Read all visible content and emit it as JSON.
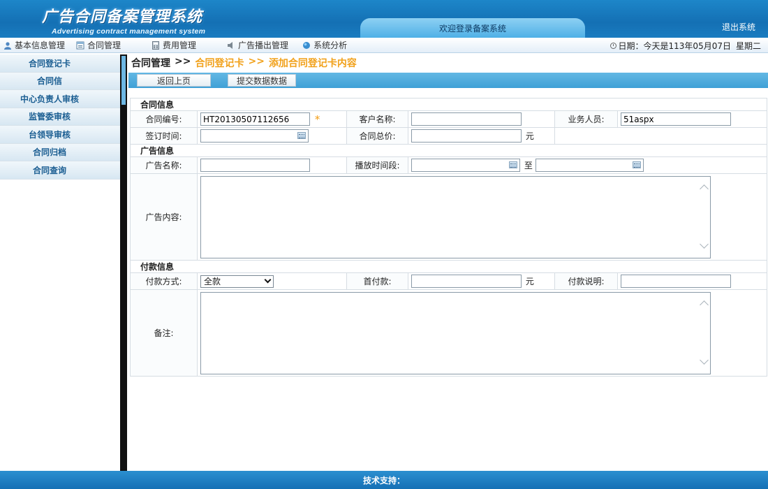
{
  "header": {
    "title": "广告合同备案管理系统",
    "subtitle": "Advertising contract management system",
    "welcome": "欢迎登录备案系统",
    "logout": "退出系统"
  },
  "topmenu": {
    "items": [
      {
        "label": "基本信息管理",
        "icon": "user-icon"
      },
      {
        "label": "合同管理",
        "icon": "document-icon"
      },
      {
        "label": "费用管理",
        "icon": "calculator-icon"
      },
      {
        "label": "广告播出管理",
        "icon": "speaker-icon"
      },
      {
        "label": "系统分析",
        "icon": "globe-icon"
      }
    ],
    "date_label": "日期：今天是113年05月07日",
    "weekday": "星期二"
  },
  "sidebar": {
    "items": [
      {
        "label": "合同登记卡"
      },
      {
        "label": "合同信"
      },
      {
        "label": "中心负责人审核"
      },
      {
        "label": "监管委审核"
      },
      {
        "label": "台领导审核"
      },
      {
        "label": "合同归档"
      },
      {
        "label": "合同查询"
      }
    ]
  },
  "breadcrumb": {
    "root": "合同管理",
    "sep1": ">>",
    "level2": "合同登记卡",
    "sep2": ">>",
    "level3": "添加合同登记卡内容"
  },
  "toolbar": {
    "back_label": "返回上页",
    "submit_label": "提交数据数据"
  },
  "form": {
    "section_contract": "合同信息",
    "contract_no_label": "合同编号:",
    "contract_no_value": "HT20130507112656",
    "required_mark": "*",
    "customer_label": "客户名称:",
    "customer_value": "",
    "salesperson_label": "业务人员:",
    "salesperson_value": "51aspx",
    "sign_time_label": "签订时间:",
    "sign_time_value": "",
    "total_price_label": "合同总价:",
    "total_price_value": "",
    "unit_yuan": "元",
    "section_ad": "广告信息",
    "ad_name_label": "广告名称:",
    "ad_name_value": "",
    "play_period_label": "播放时间段:",
    "play_start_value": "",
    "to_label": "至",
    "play_end_value": "",
    "ad_content_label": "广告内容:",
    "section_payment": "付款信息",
    "pay_method_label": "付款方式:",
    "pay_method_value": "全款",
    "first_pay_label": "首付款:",
    "first_pay_value": "",
    "pay_note_label": "付款说明:",
    "pay_note_value": "",
    "remark_label": "备注:"
  },
  "footer": {
    "support_label": "技术支持："
  }
}
